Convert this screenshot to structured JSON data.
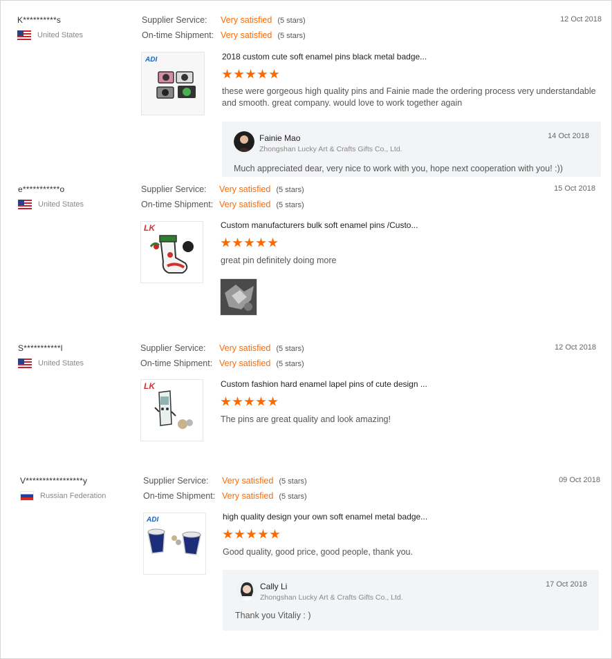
{
  "reviews": [
    {
      "buyer": "K**********s",
      "country": "United States",
      "flag": "us-flag",
      "supplier_service_label": "Supplier Service:",
      "supplier_service_value": "Very satisfied",
      "supplier_service_stars": "(5 stars)",
      "shipment_label": "On-time Shipment:",
      "shipment_value": "Very satisfied",
      "shipment_stars": "(5 stars)",
      "date": "12 Oct 2018",
      "product_logo": "ADI",
      "product_title": "2018 custom cute soft enamel pins black metal badge...",
      "product_rating": 5,
      "text_lines": [
        "these were gorgeous high quality pins and Fainie made the ordering process very understandable",
        "and smooth. great company. would love to work together again"
      ],
      "reply": {
        "name": "Fainie Mao",
        "company": "Zhongshan Lucky Art & Crafts Gifts Co., Ltd.",
        "date": "14 Oct 2018",
        "text": "Much appreciated dear, very nice to work with you, hope next cooperation with you! :))"
      }
    },
    {
      "buyer": "e***********o",
      "country": "United States",
      "flag": "us-flag",
      "supplier_service_label": "Supplier Service:",
      "supplier_service_value": "Very satisfied",
      "supplier_service_stars": "(5 stars)",
      "shipment_label": "On-time Shipment:",
      "shipment_value": "Very satisfied",
      "shipment_stars": "(5 stars)",
      "date": "15 Oct 2018",
      "product_logo": "LK",
      "product_title": "Custom manufacturers bulk soft enamel pins /Custo...",
      "product_rating": 5,
      "text_lines": [
        "great pin definitely doing more"
      ]
    },
    {
      "buyer": "S***********l",
      "country": "United States",
      "flag": "us-flag",
      "supplier_service_label": "Supplier Service:",
      "supplier_service_value": "Very satisfied",
      "supplier_service_stars": "(5 stars)",
      "shipment_label": "On-time Shipment:",
      "shipment_value": "Very satisfied",
      "shipment_stars": "(5 stars)",
      "date": "12 Oct 2018",
      "product_logo": "LK",
      "product_title": "Custom fashion hard enamel lapel pins of cute design ...",
      "product_rating": 5,
      "text_lines": [
        "The pins are great quality and look amazing!"
      ]
    },
    {
      "buyer": "V*****************y",
      "country": "Russian Federation",
      "flag": "ru-flag",
      "supplier_service_label": "Supplier Service:",
      "supplier_service_value": "Very satisfied",
      "supplier_service_stars": "(5 stars)",
      "shipment_label": "On-time Shipment:",
      "shipment_value": "Very satisfied",
      "shipment_stars": "(5 stars)",
      "date": "09 Oct 2018",
      "product_logo": "ADI",
      "product_title": "high quality design your own soft enamel metal badge...",
      "product_rating": 5,
      "text_lines": [
        "Good quality, good price, good people, thank you."
      ],
      "reply": {
        "name": "Cally Li",
        "company": "Zhongshan Lucky Art & Crafts Gifts Co., Ltd.",
        "date": "17 Oct 2018",
        "text": "Thank you Vitaliy : )"
      }
    }
  ],
  "colors": {
    "accent": "#ff6a00",
    "reply_bg": "#f3f4f6"
  }
}
